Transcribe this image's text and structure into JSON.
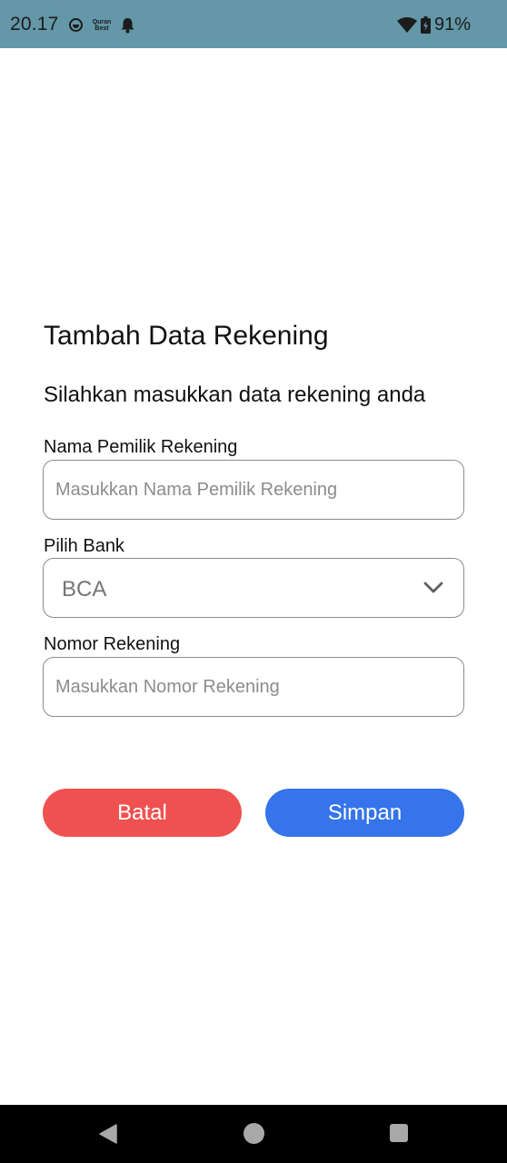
{
  "status_bar": {
    "time": "20.17",
    "quran_app_label": "Quran Best",
    "battery_text": "91%",
    "icons": [
      "alarm-clock-icon",
      "quran-app-icon",
      "bell-icon",
      "wifi-icon",
      "battery-icon"
    ]
  },
  "form": {
    "title": "Tambah Data Rekening",
    "subtitle": "Silahkan masukkan data rekening anda",
    "owner_name": {
      "label": "Nama Pemilik Rekening",
      "placeholder": "Masukkan Nama Pemilik Rekening",
      "value": ""
    },
    "bank": {
      "label": "Pilih Bank",
      "selected": "BCA"
    },
    "account_number": {
      "label": "Nomor Rekening",
      "placeholder": "Masukkan Nomor Rekening",
      "value": ""
    },
    "buttons": {
      "cancel": "Batal",
      "save": "Simpan"
    }
  },
  "colors": {
    "status_bar": "#6497a8",
    "cancel_button": "#ef5150",
    "save_button": "#3574ea",
    "nav_bar": "#000000"
  },
  "nav_bar": {
    "icons": [
      "back-icon",
      "home-icon",
      "recents-icon"
    ]
  }
}
